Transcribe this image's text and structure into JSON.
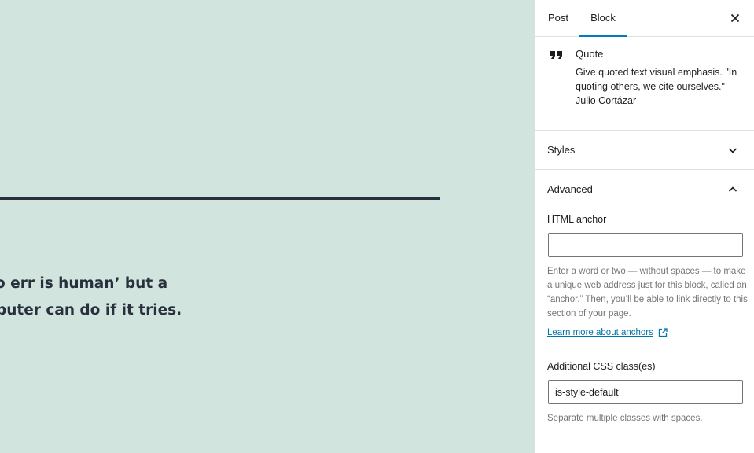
{
  "canvas": {
    "background": "#d1e4dd",
    "text_color": "#28303d",
    "quote_lines": [
      "o err is human’ but a",
      "puter can do if it tries."
    ]
  },
  "sidebar": {
    "tabs": [
      {
        "label": "Post",
        "active": false
      },
      {
        "label": "Block",
        "active": true
      }
    ],
    "accent_color": "#007cba",
    "close_icon": "close-icon",
    "block": {
      "icon": "quote-icon",
      "title": "Quote",
      "description": "Give quoted text visual emphasis. \"In quoting others, we cite ourselves.\" — Julio Cortázar"
    },
    "panels": [
      {
        "title": "Styles",
        "expanded": false,
        "icon": "chevron-down-icon"
      },
      {
        "title": "Advanced",
        "expanded": true,
        "icon": "chevron-up-icon"
      }
    ],
    "advanced": {
      "html_anchor": {
        "label": "HTML anchor",
        "value": "",
        "help": "Enter a word or two — without spaces — to make a unique web address just for this block, called an “anchor.” Then, you’ll be able to link directly to this section of your page.",
        "link_label": "Learn more about anchors",
        "link_icon": "external-link-icon"
      },
      "css_classes": {
        "label": "Additional CSS class(es)",
        "value": "is-style-default",
        "help": "Separate multiple classes with spaces."
      }
    }
  }
}
